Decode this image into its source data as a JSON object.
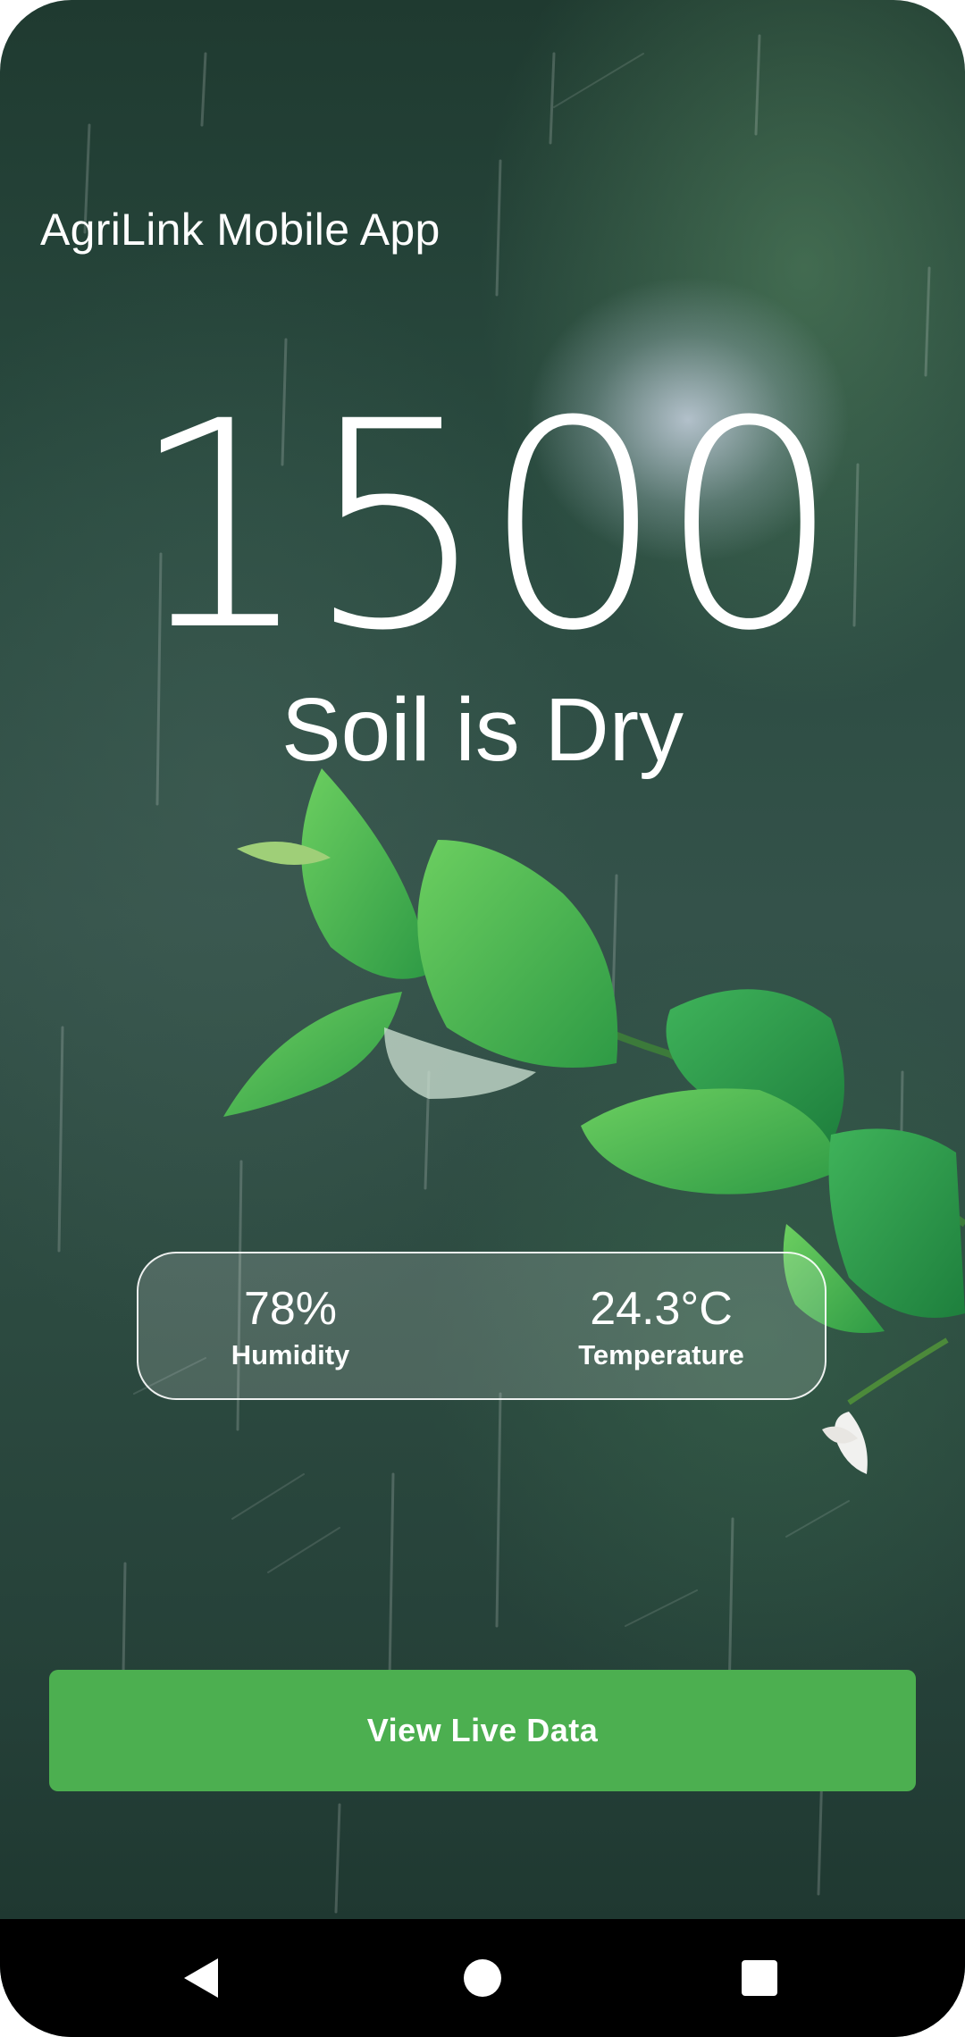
{
  "app": {
    "title": "AgriLink Mobile App"
  },
  "reading": {
    "value": "1500",
    "status": "Soil is Dry"
  },
  "stats": {
    "humidity": {
      "value": "78%",
      "label": "Humidity"
    },
    "temperature": {
      "value": "24.3°C",
      "label": "Temperature"
    }
  },
  "actions": {
    "live_data_label": "View Live Data"
  },
  "colors": {
    "button": "#4caf50",
    "text": "#ffffff",
    "nav_bar": "#000000"
  },
  "nav": {
    "back_icon": "back-triangle-icon",
    "home_icon": "home-circle-icon",
    "recents_icon": "recents-square-icon"
  }
}
